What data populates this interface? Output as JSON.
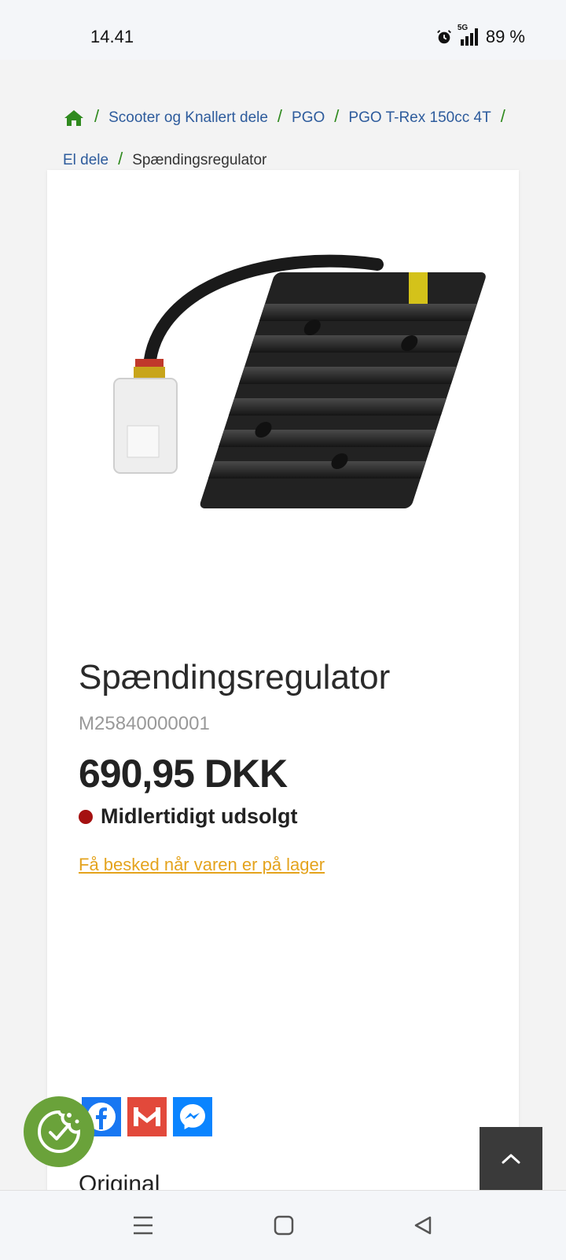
{
  "status": {
    "time": "14.41",
    "network": "5G",
    "battery": "89 %"
  },
  "breadcrumb": {
    "items": [
      "Scooter og Knallert dele",
      "PGO",
      "PGO T-Rex 150cc 4T",
      "El dele"
    ],
    "current": "Spændingsregulator"
  },
  "product": {
    "title": "Spændingsregulator",
    "sku": "M25840000001",
    "price": "690,95 DKK",
    "stock_status": "Midlertidigt udsolgt",
    "notify_link": "Få besked når varen er på lager",
    "section_heading": "Original"
  },
  "icons": {
    "home": "home-icon",
    "facebook": "facebook-icon",
    "gmail": "gmail-icon",
    "messenger": "messenger-icon",
    "cookie": "cookie-consent-icon",
    "scroll_top": "chevron-up-icon"
  },
  "colors": {
    "breadcrumb_link": "#2d5b9c",
    "separator": "#2f8a1e",
    "out_of_stock": "#a51111",
    "notify_link": "#e4a31d",
    "cookie_button": "#6aa23a"
  }
}
